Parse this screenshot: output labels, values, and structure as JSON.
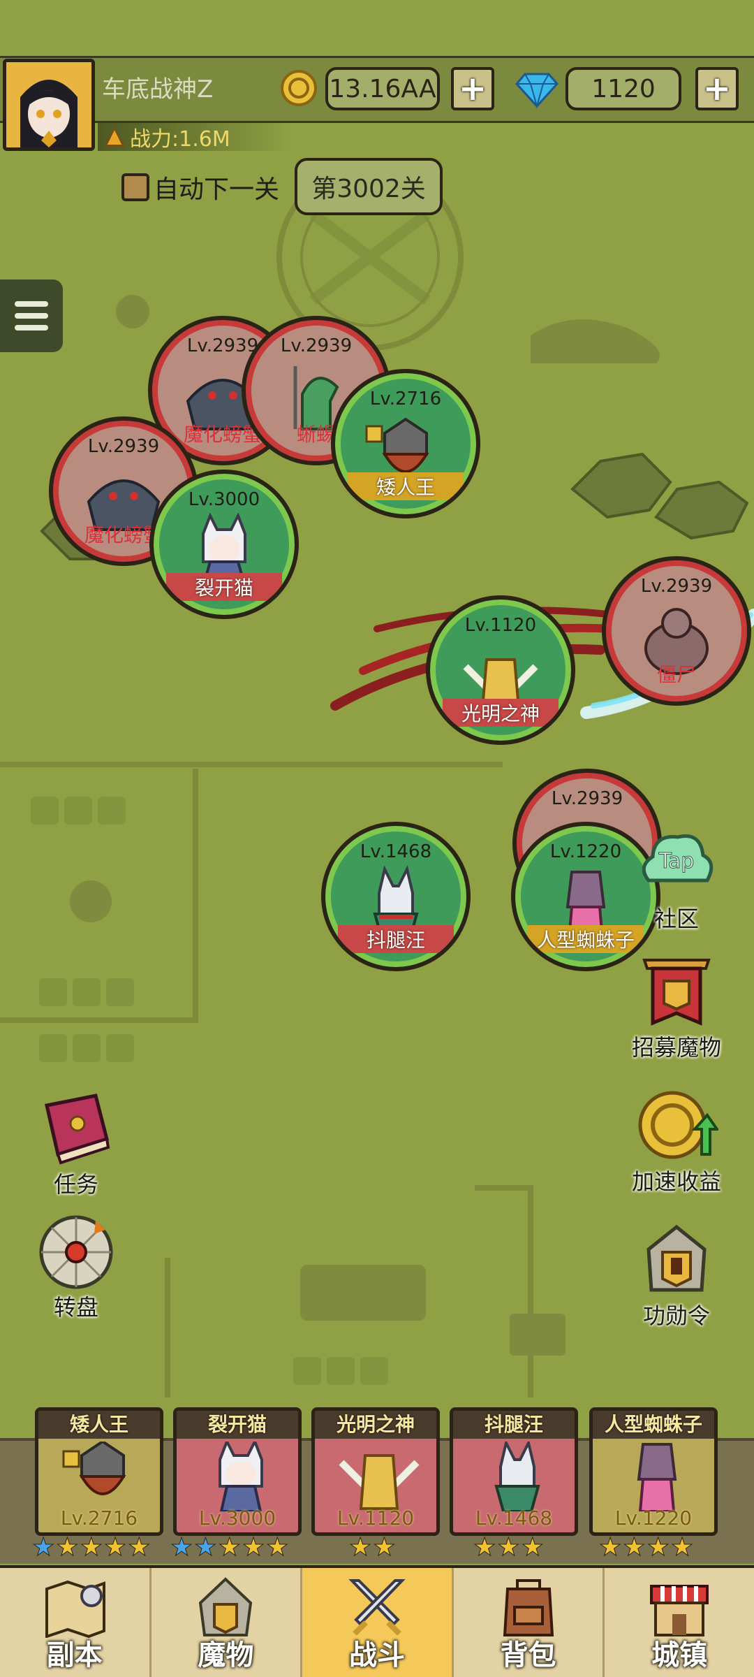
{
  "player": {
    "name": "车底战神Z",
    "power": "战力:1.6M"
  },
  "currency": {
    "coins": "13.16AA",
    "gems": "1120",
    "plus": "+"
  },
  "stage": {
    "auto_next_label": "自动下一关",
    "current": "第3002关"
  },
  "battle": {
    "allies": [
      {
        "level": "Lv.2716",
        "name": "矮人王"
      },
      {
        "level": "Lv.3000",
        "name": "裂开猫"
      },
      {
        "level": "Lv.1120",
        "name": "光明之神"
      },
      {
        "level": "Lv.1468",
        "name": "抖腿汪"
      },
      {
        "level": "Lv.1220",
        "name": "人型蜘蛛子"
      }
    ],
    "enemies": [
      {
        "level": "Lv.2939",
        "name": "魔化螃蟹"
      },
      {
        "level": "Lv.2939",
        "name": "蜥蜴"
      },
      {
        "level": "Lv.2939",
        "name": "魔化螃蟹"
      },
      {
        "level": "Lv.2939",
        "name": "僵尸"
      },
      {
        "level": "Lv.2939",
        "name": ""
      }
    ]
  },
  "side_left": [
    {
      "label": "任务",
      "icon": "book-icon"
    },
    {
      "label": "转盘",
      "icon": "wheel-icon"
    }
  ],
  "side_right": [
    {
      "label": "社区",
      "icon": "tap-cloud-icon",
      "badge": "Tap"
    },
    {
      "label": "招募魔物",
      "icon": "banner-helmet-icon"
    },
    {
      "label": "加速收益",
      "icon": "coin-arrow-icon"
    },
    {
      "label": "功勋令",
      "icon": "helmet-icon"
    }
  ],
  "team": [
    {
      "name": "矮人王",
      "level": "Lv.2716",
      "stars": [
        "blue",
        "gold",
        "gold",
        "gold",
        "gold"
      ]
    },
    {
      "name": "裂开猫",
      "level": "Lv.3000",
      "stars": [
        "blue",
        "blue",
        "gold",
        "gold",
        "gold"
      ]
    },
    {
      "name": "光明之神",
      "level": "Lv.1120",
      "stars": [
        "gold",
        "gold"
      ]
    },
    {
      "name": "抖腿汪",
      "level": "Lv.1468",
      "stars": [
        "gold",
        "gold",
        "gold"
      ]
    },
    {
      "name": "人型蜘蛛子",
      "level": "Lv.1220",
      "stars": [
        "gold",
        "gold",
        "gold",
        "gold"
      ]
    }
  ],
  "nav": [
    {
      "label": "副本",
      "icon": "map-icon"
    },
    {
      "label": "魔物",
      "icon": "monster-helmet-icon"
    },
    {
      "label": "战斗",
      "icon": "crossed-swords-icon",
      "active": true
    },
    {
      "label": "背包",
      "icon": "backpack-icon"
    },
    {
      "label": "城镇",
      "icon": "shop-icon"
    }
  ],
  "colors": {
    "background": "#8fa144",
    "ally_ring": "#7ec84e",
    "enemy_ring": "#c83a3a",
    "active_tab": "#f4c95a"
  }
}
